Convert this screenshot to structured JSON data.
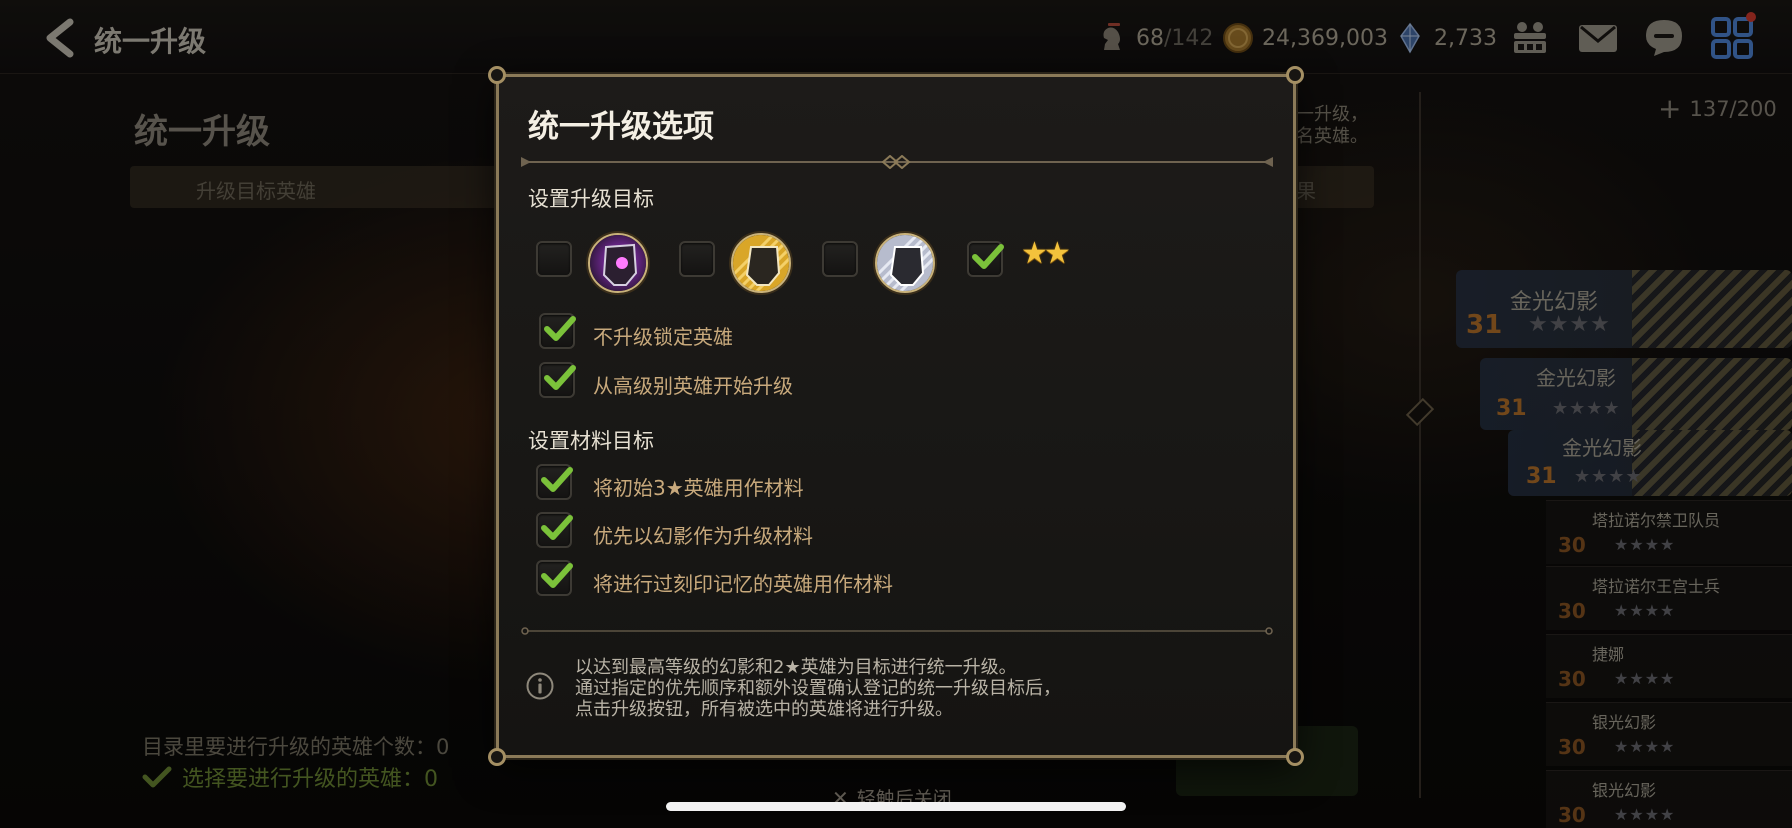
{
  "topbar": {
    "title": "统一升级",
    "hero_slots_used": "68",
    "hero_slots_max": "/142",
    "gold": "24,369,003",
    "crystals": "2,733"
  },
  "background_page": {
    "title": "统一升级",
    "tab_label": "升级目标英雄",
    "tab_right_fragment": "果",
    "note_line1": "一升级，",
    "note_line2": "名英雄。",
    "roster_count": "137/200",
    "count_line": "目录里要进行升级的英雄个数：0",
    "selected_line": "选择要进行升级的英雄：0",
    "heroes": [
      {
        "name": "金光幻影",
        "level": "31",
        "stars": "★★★★"
      },
      {
        "name": "金光幻影",
        "level": "31",
        "stars": "★★★★"
      },
      {
        "name": "金光幻影",
        "level": "31",
        "stars": "★★★★"
      },
      {
        "name": "塔拉诺尔禁卫队员",
        "level": "30",
        "stars": "★★★★"
      },
      {
        "name": "塔拉诺尔王宫士兵",
        "level": "30",
        "stars": "★★★★"
      },
      {
        "name": "捷娜",
        "level": "30",
        "stars": "★★★★"
      },
      {
        "name": "银光幻影",
        "level": "30",
        "stars": "★★★★"
      },
      {
        "name": "银光幻影",
        "level": "30",
        "stars": "★★★★"
      }
    ]
  },
  "modal": {
    "title": "统一升级选项",
    "section_target": "设置升级目标",
    "target_options": [
      {
        "name": "purple-phantom",
        "checked": false
      },
      {
        "name": "gold-phantom",
        "checked": false
      },
      {
        "name": "silver-phantom",
        "checked": false
      },
      {
        "name": "two-star-hero",
        "checked": true,
        "label": "★★"
      }
    ],
    "options_target": [
      {
        "label": "不升级锁定英雄",
        "checked": true
      },
      {
        "label": "从高级别英雄开始升级",
        "checked": true
      }
    ],
    "section_material": "设置材料目标",
    "options_material": [
      {
        "label": "将初始3★英雄用作材料",
        "checked": true
      },
      {
        "label": "优先以幻影作为升级材料",
        "checked": true
      },
      {
        "label": "将进行过刻印记忆的英雄用作材料",
        "checked": true
      }
    ],
    "info_line1": "以达到最高等级的幻影和2★英雄为目标进行统一升级。",
    "info_line2": "通过指定的优先顺序和额外设置确认登记的统一升级目标后，",
    "info_line3": "点击升级按钮，所有被选中的英雄将进行升级。"
  },
  "close_hint": "轻触后关闭",
  "colors": {
    "check_green": "#7bc23a",
    "option_text": "#c8a97c",
    "frame_gold": "#8b7a58",
    "star_gold": "#f3c23c"
  }
}
